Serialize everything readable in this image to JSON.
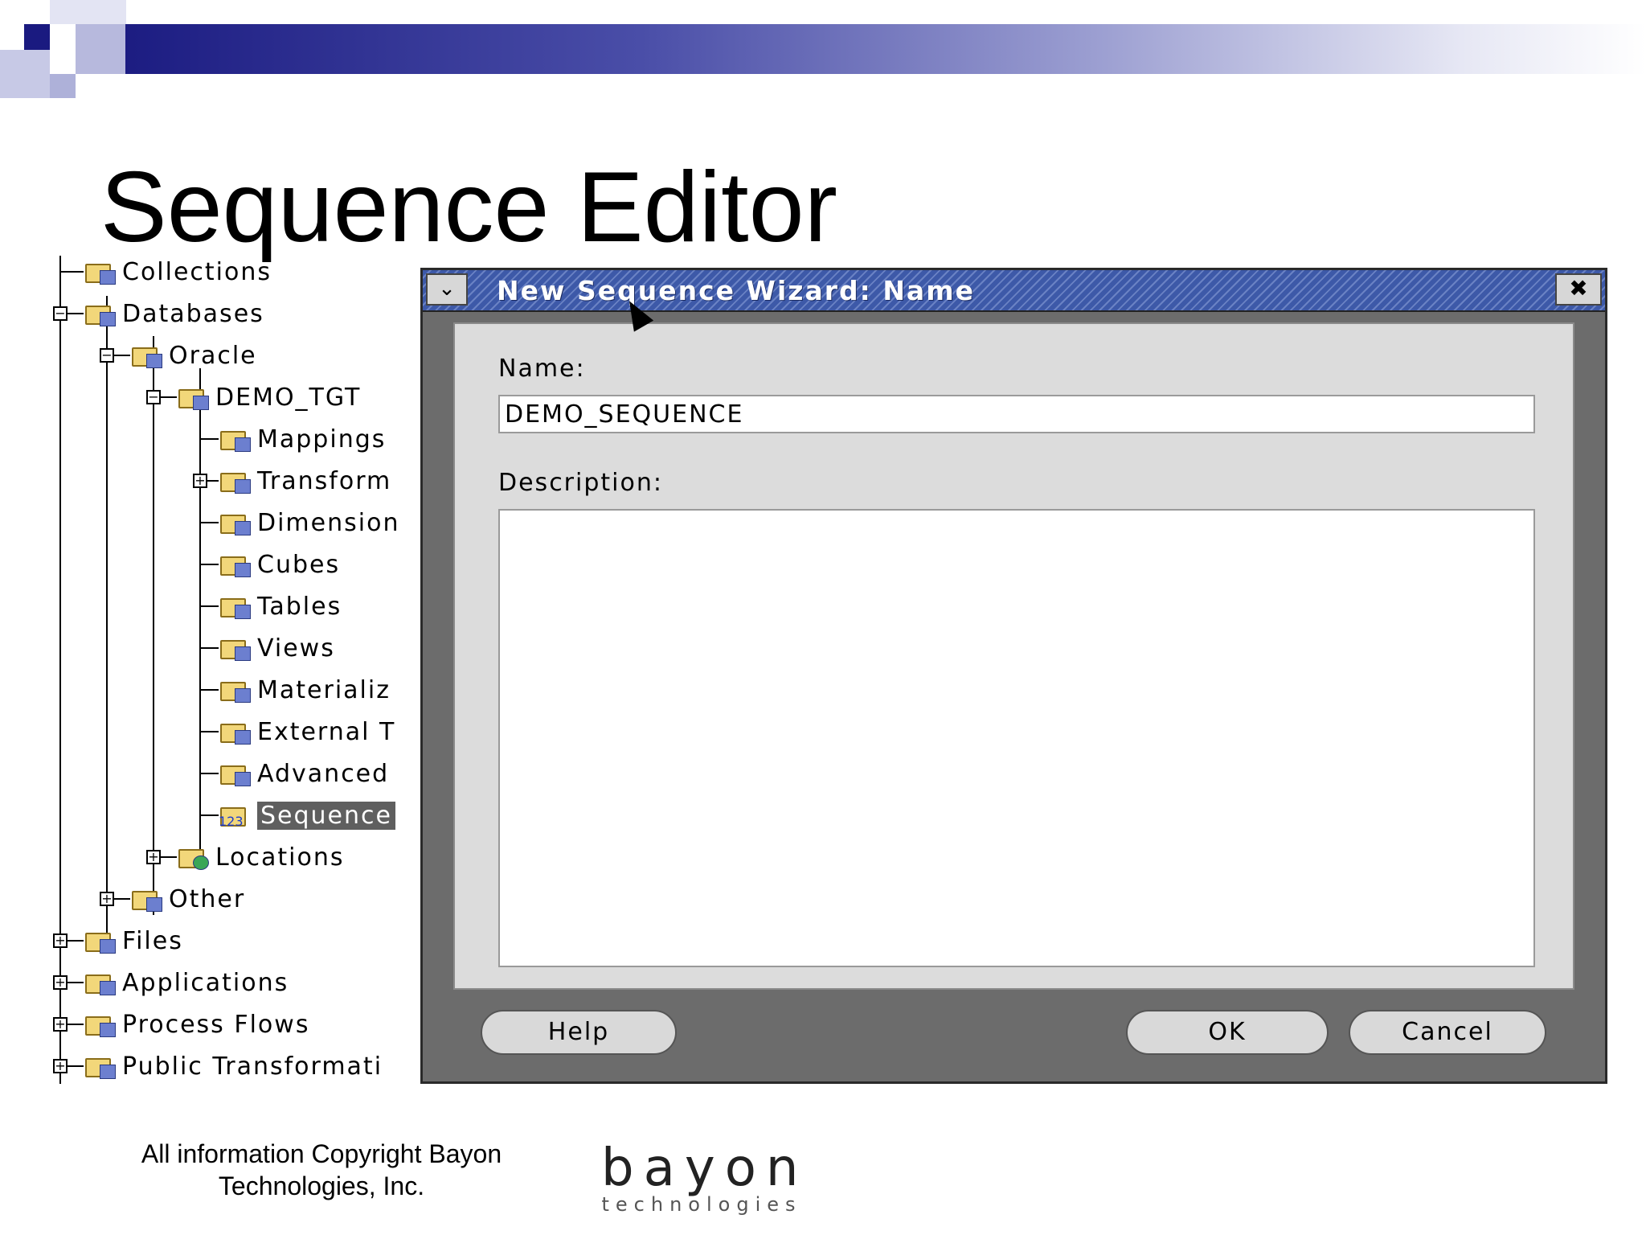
{
  "slide": {
    "title": "Sequence Editor",
    "copyright": "All information Copyright Bayon Technologies, Inc.",
    "logo": {
      "main": "bayon",
      "sub": "technologies"
    }
  },
  "tree": {
    "items": [
      {
        "label": "Collections"
      },
      {
        "label": "Databases"
      },
      {
        "label": "Oracle"
      },
      {
        "label": "DEMO_TGT"
      },
      {
        "label": "Mappings"
      },
      {
        "label": "Transform"
      },
      {
        "label": "Dimension"
      },
      {
        "label": "Cubes"
      },
      {
        "label": "Tables"
      },
      {
        "label": "Views"
      },
      {
        "label": "Materializ"
      },
      {
        "label": "External T"
      },
      {
        "label": "Advanced"
      },
      {
        "label": "Sequence"
      },
      {
        "label": "Locations"
      },
      {
        "label": "Other"
      },
      {
        "label": "Files"
      },
      {
        "label": "Applications"
      },
      {
        "label": "Process Flows"
      },
      {
        "label": "Public Transformati"
      }
    ]
  },
  "dialog": {
    "title": "New Sequence Wizard: Name",
    "name_label": "Name:",
    "name_value": "DEMO_SEQUENCE",
    "description_label": "Description:",
    "description_value": "",
    "help_label": "Help",
    "ok_label": "OK",
    "cancel_label": "Cancel",
    "menu_icon": "chevron-down-icon",
    "close_icon": "close-icon"
  },
  "colors": {
    "title_bar": "#3d59a8",
    "dialog_frame": "#6c6c6c",
    "dialog_panel": "#dcdcdc",
    "selection": "#5f5f5f",
    "header_band": "#1a1a80"
  }
}
